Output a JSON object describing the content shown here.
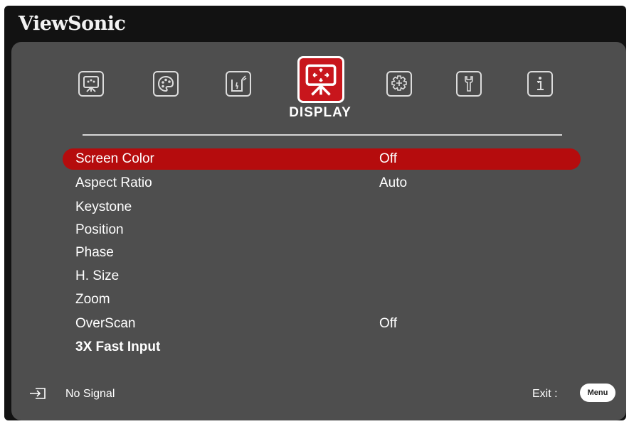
{
  "header": {
    "brand": "ViewSonic"
  },
  "tabs": [
    {
      "icon": "picture-icon",
      "active": false
    },
    {
      "icon": "color-palette-icon",
      "active": false
    },
    {
      "icon": "power-icon",
      "active": false
    },
    {
      "icon": "display-icon",
      "active": true
    },
    {
      "icon": "advanced-gear-icon",
      "active": false
    },
    {
      "icon": "system-wrench-icon",
      "active": false
    },
    {
      "icon": "information-icon",
      "active": false
    }
  ],
  "active_tab_label": "DISPLAY",
  "menu": {
    "items": [
      {
        "label": "Screen Color",
        "value": "Off",
        "selected": true
      },
      {
        "label": "Aspect Ratio",
        "value": "Auto",
        "selected": false
      },
      {
        "label": "Keystone",
        "value": "",
        "selected": false
      },
      {
        "label": "Position",
        "value": "",
        "selected": false
      },
      {
        "label": "Phase",
        "value": "",
        "selected": false
      },
      {
        "label": "H. Size",
        "value": "",
        "selected": false
      },
      {
        "label": "Zoom",
        "value": "",
        "selected": false
      },
      {
        "label": "OverScan",
        "value": "Off",
        "selected": false
      },
      {
        "label": "3X Fast Input",
        "value": "",
        "selected": false
      }
    ]
  },
  "footer": {
    "input_icon": "input-source-icon",
    "signal_status": "No Signal",
    "exit_label": "Exit :",
    "menu_button_label": "Menu"
  },
  "colors": {
    "highlight": "#b50c0d",
    "active_tab": "#c8161c",
    "panel": "#4e4e4e",
    "frame": "#121212"
  }
}
